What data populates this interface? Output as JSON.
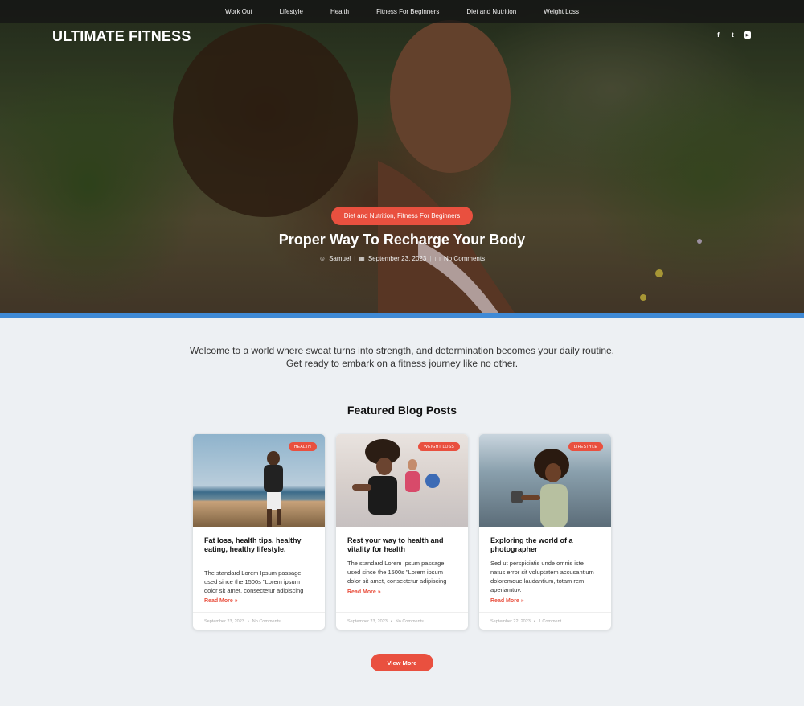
{
  "nav": {
    "items": [
      "Work Out",
      "Lifestyle",
      "Health",
      "Fitness For Beginners",
      "Diet and Nutrition",
      "Weight Loss"
    ]
  },
  "brand": {
    "name": "ULTIMATE FITNESS"
  },
  "social": {
    "facebook": "f",
    "twitter": "t",
    "youtube": "▶"
  },
  "hero": {
    "badge": "Diet and Nutrition, Fitness For Beginners",
    "title": "Proper Way To Recharge Your Body",
    "author": "Samuel",
    "date": "September 23, 2023",
    "comments": "No Comments"
  },
  "intro": {
    "text": "Welcome to a world where sweat turns into strength, and determination becomes your daily routine. Get ready to embark on a fitness journey like no other."
  },
  "featured": {
    "title": "Featured Blog Posts",
    "cards": [
      {
        "badge": "HEALTH",
        "title": "Fat loss, health tips, healthy eating, healthy lifestyle.",
        "excerpt": "The standard Lorem Ipsum passage, used since the 1500s \"Lorem ipsum dolor sit amet, consectetur adipiscing",
        "read_more": "Read More »",
        "date": "September 23, 2023",
        "comments": "No Comments"
      },
      {
        "badge": "WEIGHT LOSS",
        "title": "Rest your way to health and vitality for health",
        "excerpt": "The standard Lorem Ipsum passage, used since the 1500s \"Lorem ipsum dolor sit amet, consectetur adipiscing",
        "read_more": "Read More »",
        "date": "September 23, 2023",
        "comments": "No Comments"
      },
      {
        "badge": "LIFESTYLE",
        "title": "Exploring the world of a photographer",
        "excerpt": "Sed ut perspiciatis unde omnis iste natus error sit voluptatem accusantium doloremque laudantium, totam rem aperiamtuv.",
        "read_more": "Read More »",
        "date": "September 22, 2023",
        "comments": "1 Comment"
      }
    ],
    "view_more": "View More"
  },
  "colors": {
    "accent": "#e9503f",
    "divider": "#3f8ad6",
    "background": "#edf0f3"
  }
}
